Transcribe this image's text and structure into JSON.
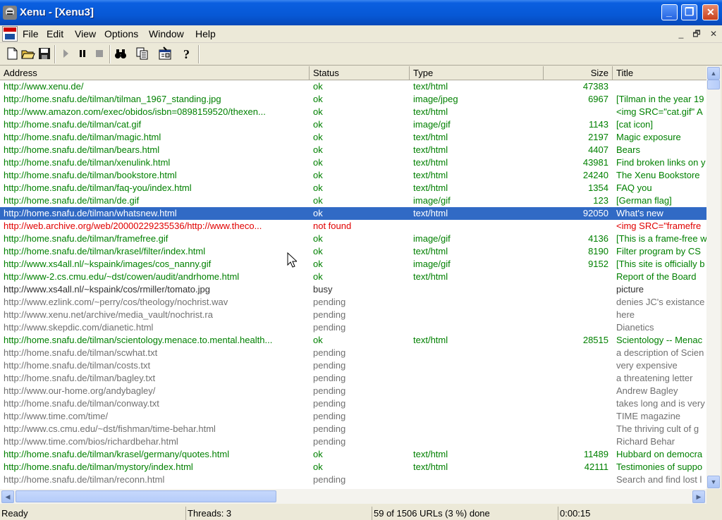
{
  "window": {
    "title": "Xenu - [Xenu3]",
    "minimize_glyph": "_",
    "maximize_glyph": "❐",
    "close_glyph": "✕"
  },
  "menu": {
    "items": [
      "File",
      "Edit",
      "View",
      "Options",
      "Window",
      "Help"
    ]
  },
  "mdi_controls": [
    "_",
    "🗗",
    "✕"
  ],
  "toolbar": {
    "icons": [
      "new-file-icon",
      "open-folder-icon",
      "save-icon",
      "play-icon",
      "pause-icon",
      "stop-icon",
      "binoculars-icon",
      "copy-icon",
      "properties-icon",
      "help-icon"
    ]
  },
  "columns": {
    "address": "Address",
    "status": "Status",
    "type": "Type",
    "size": "Size",
    "title": "Title"
  },
  "rows": [
    {
      "address": "http://www.xenu.de/",
      "status": "ok",
      "type": "text/html",
      "size": "47383",
      "title": "",
      "state": "ok"
    },
    {
      "address": "http://home.snafu.de/tilman/tilman_1967_standing.jpg",
      "status": "ok",
      "type": "image/jpeg",
      "size": "6967",
      "title": "[Tilman in the year 19",
      "state": "ok"
    },
    {
      "address": "http://www.amazon.com/exec/obidos/isbn=0898159520/thexen...",
      "status": "ok",
      "type": "text/html",
      "size": "",
      "title": "<img SRC=\"cat.gif\" A",
      "state": "ok"
    },
    {
      "address": "http://home.snafu.de/tilman/cat.gif",
      "status": "ok",
      "type": "image/gif",
      "size": "1143",
      "title": "[cat icon]",
      "state": "ok"
    },
    {
      "address": "http://home.snafu.de/tilman/magic.html",
      "status": "ok",
      "type": "text/html",
      "size": "2197",
      "title": "Magic exposure",
      "state": "ok"
    },
    {
      "address": "http://home.snafu.de/tilman/bears.html",
      "status": "ok",
      "type": "text/html",
      "size": "4407",
      "title": "Bears",
      "state": "ok"
    },
    {
      "address": "http://home.snafu.de/tilman/xenulink.html",
      "status": "ok",
      "type": "text/html",
      "size": "43981",
      "title": "Find broken links on y",
      "state": "ok"
    },
    {
      "address": "http://home.snafu.de/tilman/bookstore.html",
      "status": "ok",
      "type": "text/html",
      "size": "24240",
      "title": "The Xenu Bookstore",
      "state": "ok"
    },
    {
      "address": "http://home.snafu.de/tilman/faq-you/index.html",
      "status": "ok",
      "type": "text/html",
      "size": "1354",
      "title": "FAQ you",
      "state": "ok"
    },
    {
      "address": "http://home.snafu.de/tilman/de.gif",
      "status": "ok",
      "type": "image/gif",
      "size": "123",
      "title": "[German flag]",
      "state": "ok"
    },
    {
      "address": "http://home.snafu.de/tilman/whatsnew.html",
      "status": "ok",
      "type": "text/html",
      "size": "92050",
      "title": "What's new",
      "state": "selected"
    },
    {
      "address": "http://web.archive.org/web/20000229235536/http://www.theco...",
      "status": "not found",
      "type": "",
      "size": "",
      "title": "<img SRC=\"framefre",
      "state": "notfound"
    },
    {
      "address": "http://home.snafu.de/tilman/framefree.gif",
      "status": "ok",
      "type": "image/gif",
      "size": "4136",
      "title": "[This is a frame-free w",
      "state": "ok"
    },
    {
      "address": "http://home.snafu.de/tilman/krasel/filter/index.html",
      "status": "ok",
      "type": "text/html",
      "size": "8190",
      "title": "Filter program by CS",
      "state": "ok"
    },
    {
      "address": "http://www.xs4all.nl/~kspaink/images/cos_nanny.gif",
      "status": "ok",
      "type": "image/gif",
      "size": "9152",
      "title": "[This site is officially b",
      "state": "ok"
    },
    {
      "address": "http://www-2.cs.cmu.edu/~dst/cowen/audit/andrhome.html",
      "status": "ok",
      "type": "text/html",
      "size": "",
      "title": "Report of the Board",
      "state": "ok"
    },
    {
      "address": "http://www.xs4all.nl/~kspaink/cos/rmiller/tomato.jpg",
      "status": "busy",
      "type": "",
      "size": "",
      "title": "picture",
      "state": "busy"
    },
    {
      "address": "http://www.ezlink.com/~perry/cos/theology/nochrist.wav",
      "status": "pending",
      "type": "",
      "size": "",
      "title": "denies JC's existance",
      "state": "pending"
    },
    {
      "address": "http://www.xenu.net/archive/media_vault/nochrist.ra",
      "status": "pending",
      "type": "",
      "size": "",
      "title": "here",
      "state": "pending"
    },
    {
      "address": "http://www.skepdic.com/dianetic.html",
      "status": "pending",
      "type": "",
      "size": "",
      "title": "Dianetics",
      "state": "pending"
    },
    {
      "address": "http://home.snafu.de/tilman/scientology.menace.to.mental.health...",
      "status": "ok",
      "type": "text/html",
      "size": "28515",
      "title": "Scientology -- Menac",
      "state": "ok"
    },
    {
      "address": "http://home.snafu.de/tilman/scwhat.txt",
      "status": "pending",
      "type": "",
      "size": "",
      "title": "a description of Scien",
      "state": "pending"
    },
    {
      "address": "http://home.snafu.de/tilman/costs.txt",
      "status": "pending",
      "type": "",
      "size": "",
      "title": "very expensive",
      "state": "pending"
    },
    {
      "address": "http://home.snafu.de/tilman/bagley.txt",
      "status": "pending",
      "type": "",
      "size": "",
      "title": "a threatening letter",
      "state": "pending"
    },
    {
      "address": "http://www.our-home.org/andybagley/",
      "status": "pending",
      "type": "",
      "size": "",
      "title": "Andrew Bagley",
      "state": "pending"
    },
    {
      "address": "http://home.snafu.de/tilman/conway.txt",
      "status": "pending",
      "type": "",
      "size": "",
      "title": "takes long and is very",
      "state": "pending"
    },
    {
      "address": "http://www.time.com/time/",
      "status": "pending",
      "type": "",
      "size": "",
      "title": "TIME magazine",
      "state": "pending"
    },
    {
      "address": "http://www.cs.cmu.edu/~dst/fishman/time-behar.html",
      "status": "pending",
      "type": "",
      "size": "",
      "title": "The thriving cult of g",
      "state": "pending"
    },
    {
      "address": "http://www.time.com/bios/richardbehar.html",
      "status": "pending",
      "type": "",
      "size": "",
      "title": "Richard Behar",
      "state": "pending"
    },
    {
      "address": "http://home.snafu.de/tilman/krasel/germany/quotes.html",
      "status": "ok",
      "type": "text/html",
      "size": "11489",
      "title": "Hubbard on democra",
      "state": "ok"
    },
    {
      "address": "http://home.snafu.de/tilman/mystory/index.html",
      "status": "ok",
      "type": "text/html",
      "size": "42111",
      "title": "Testimonies of suppo",
      "state": "ok"
    },
    {
      "address": "http://home.snafu.de/tilman/reconn.html",
      "status": "pending",
      "type": "",
      "size": "",
      "title": "Search and find lost l",
      "state": "pending"
    }
  ],
  "statusbar": {
    "ready": "Ready",
    "threads": "Threads: 3",
    "progress": "59 of 1506 URLs (3 %) done",
    "elapsed": "0:00:15"
  },
  "colors": {
    "ok": "#008000",
    "not_found": "#e00000",
    "pending": "#707070",
    "selection": "#316ac5"
  }
}
